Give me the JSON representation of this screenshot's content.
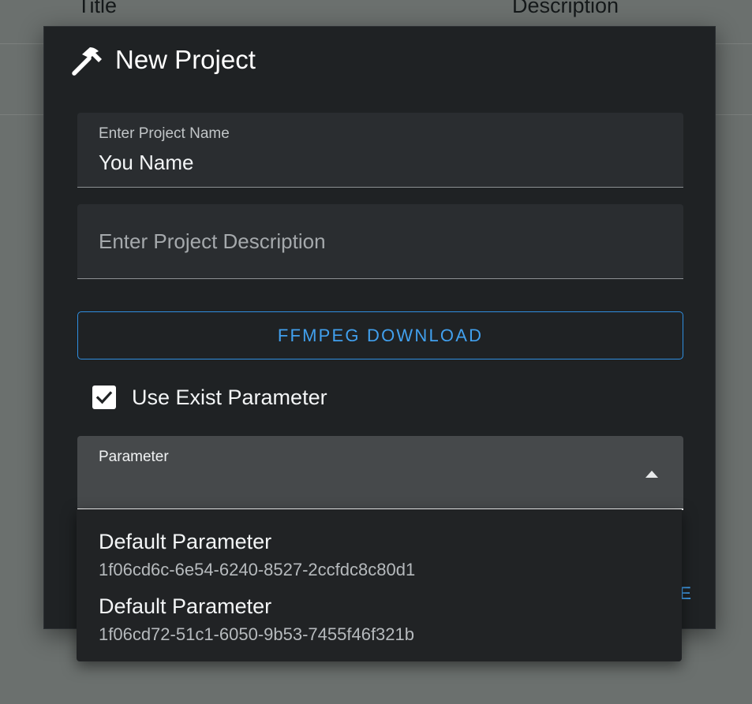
{
  "background": {
    "columns": [
      "Title",
      "Description"
    ]
  },
  "dialog": {
    "title": "New Project",
    "icon": "hammer-icon",
    "name_field": {
      "label": "Enter Project Name",
      "value": "You Name"
    },
    "description_field": {
      "placeholder": "Enter Project Description",
      "value": ""
    },
    "ffmpeg_button_label": "FFMPEG DOWNLOAD",
    "use_exist_checkbox": {
      "label": "Use Exist Parameter",
      "checked": true
    },
    "parameter_select": {
      "label": "Parameter",
      "value": ""
    },
    "action_partial_label": "E"
  },
  "parameter_menu": {
    "options": [
      {
        "title": "Default Parameter",
        "id": "1f06cd6c-6e54-6240-8527-2ccfdc8c80d1"
      },
      {
        "title": "Default Parameter",
        "id": "1f06cd72-51c1-6050-9b53-7455f46f321b"
      }
    ]
  },
  "colors": {
    "accent": "#41a0ee",
    "dialog_bg": "#1f2224",
    "field_bg": "#2a2d30",
    "backdrop": "#6b706e"
  }
}
